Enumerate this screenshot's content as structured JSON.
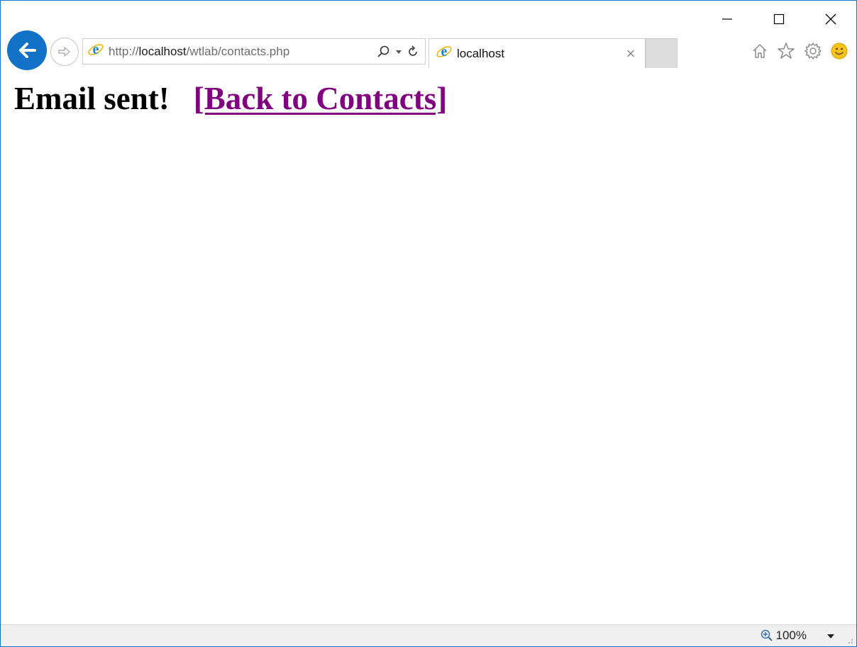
{
  "window": {
    "minimize_icon": "minimize-icon",
    "maximize_icon": "maximize-icon",
    "close_icon": "close-icon"
  },
  "nav": {
    "back_icon": "back-arrow-icon",
    "forward_icon": "forward-arrow-icon"
  },
  "address": {
    "url_prefix": "http://",
    "url_host": "localhost",
    "url_path": "/wtlab/contacts.php"
  },
  "tab": {
    "title": "localhost",
    "close": "×"
  },
  "toolbar_icons": [
    "home-icon",
    "favorites-star-icon",
    "gear-icon",
    "smiley-feedback-icon"
  ],
  "page": {
    "message": "Email sent!",
    "link_text": "[Back to Contacts]"
  },
  "status": {
    "zoom": "100%"
  },
  "colors": {
    "accent": "#1172c8",
    "link_visited": "#800080",
    "frame_border": "#1a73c8"
  }
}
